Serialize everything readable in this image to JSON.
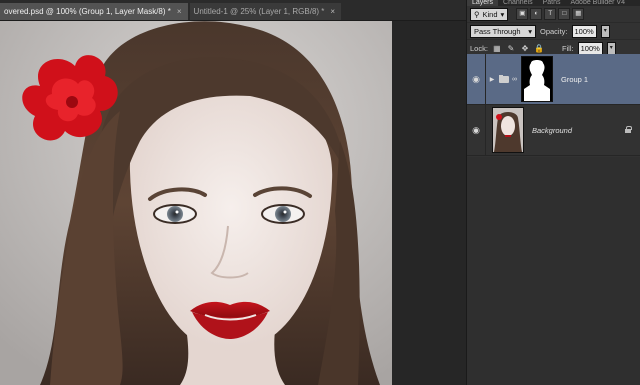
{
  "documentTabs": [
    {
      "label": "overed.psd @ 100% (Group 1, Layer Mask/8) *",
      "close": "×",
      "active": true
    },
    {
      "label": "Untitled-1 @ 25% (Layer 1, RGB/8) *",
      "close": "×",
      "active": false
    }
  ],
  "panel": {
    "tabs": [
      "Layers",
      "Channels",
      "Paths",
      "Adobe Builder V4"
    ],
    "filter": {
      "label": "Kind",
      "icon": "search-icon"
    },
    "blendMode": "Pass Through",
    "opacity": {
      "label": "Opacity:",
      "value": "100%"
    },
    "lock": {
      "label": "Lock:"
    },
    "fill": {
      "label": "Fill:",
      "value": "100%"
    },
    "layers": [
      {
        "name": "Group 1",
        "type": "group",
        "selected": true,
        "visible": true
      },
      {
        "name": "Background",
        "type": "image",
        "selected": false,
        "visible": true,
        "locked": true
      }
    ]
  },
  "colors": {
    "selectedLayer": "#5a6a86",
    "panelBg": "#323232",
    "activeTab": "#535353"
  }
}
